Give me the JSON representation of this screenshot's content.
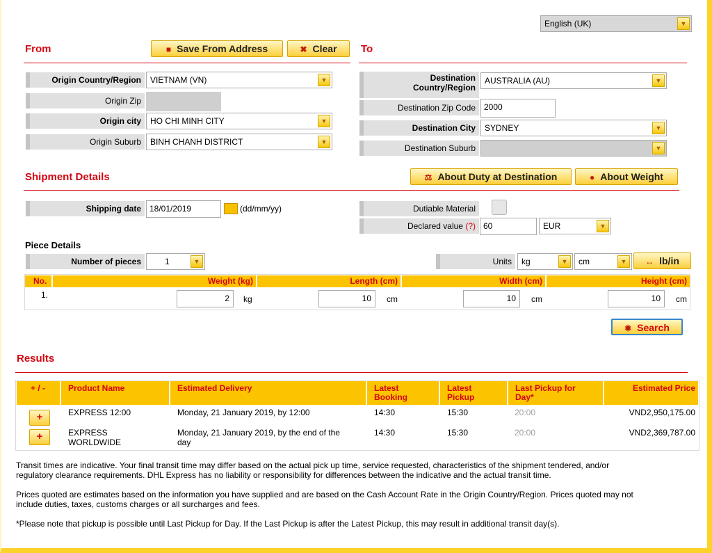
{
  "language": {
    "selected": "English (UK)"
  },
  "from": {
    "title": "From",
    "save_button": "Save From Address",
    "clear_button": "Clear",
    "country_label": "Origin Country/Region",
    "country_value": "VIETNAM (VN)",
    "zip_label": "Origin Zip",
    "city_label": "Origin city",
    "city_value": "HO CHI MINH CITY",
    "suburb_label": "Origin Suburb",
    "suburb_value": "BINH CHANH DISTRICT"
  },
  "to": {
    "title": "To",
    "country_label_1": "Destination",
    "country_label_2": "Country/Region",
    "country_value": "AUSTRALIA (AU)",
    "zip_label": "Destination Zip Code",
    "zip_value": "2000",
    "city_label": "Destination City",
    "city_value": "SYDNEY",
    "suburb_label": "Destination Suburb",
    "suburb_value": ""
  },
  "shipment": {
    "title": "Shipment Details",
    "duty_button": "About Duty at Destination",
    "weight_button": "About Weight",
    "date_label": "Shipping date",
    "date_value": "18/01/2019",
    "date_format": "(dd/mm/yy)",
    "dutiable_label": "Dutiable Material",
    "declared_label": "Declared value",
    "declared_help": "(?)",
    "declared_value": "60",
    "currency": "EUR"
  },
  "pieces": {
    "title": "Piece Details",
    "count_label": "Number of pieces",
    "count_value": "1",
    "units_label": "Units",
    "weight_unit": "kg",
    "length_unit": "cm",
    "toggle_button": "lb/in",
    "columns": {
      "no": "No.",
      "weight": "Weight (kg)",
      "length": "Length (cm)",
      "width": "Width (cm)",
      "height": "Height (cm)"
    },
    "row": {
      "no": "1.",
      "weight": "2",
      "weight_unit": "kg",
      "length": "10",
      "length_unit": "cm",
      "width": "10",
      "width_unit": "cm",
      "height": "10",
      "height_unit": "cm"
    },
    "search_button": "Search"
  },
  "results": {
    "title": "Results",
    "columns": {
      "toggle": "+ / -",
      "product": "Product Name",
      "delivery": "Estimated Delivery",
      "booking": [
        "Latest",
        "Booking"
      ],
      "pickup": [
        "Latest",
        "Pickup"
      ],
      "last_pickup": [
        "Last Pickup for",
        "Day*"
      ],
      "price": "Estimated Price"
    },
    "rows": [
      {
        "product": [
          "EXPRESS 12:00",
          ""
        ],
        "delivery": [
          "Monday, 21 January 2019, by 12:00",
          ""
        ],
        "booking": "14:30",
        "pickup": "15:30",
        "last_pickup": "20:00",
        "price": "VND2,950,175.00"
      },
      {
        "product": [
          "EXPRESS",
          "WORLDWIDE"
        ],
        "delivery": [
          "Monday, 21 January 2019, by the end of the",
          "day"
        ],
        "booking": "14:30",
        "pickup": "15:30",
        "last_pickup": "20:00",
        "price": "VND2,369,787.00"
      }
    ],
    "plus": "+"
  },
  "notes": {
    "transit": [
      "Transit times are indicative. Your final transit time may differ based on the actual pick up time, service requested, characteristics of the shipment tendered, and/or",
      "regulatory clearance requirements. DHL Express has no liability or responsibility for differences between the indicative and the actual transit time."
    ],
    "prices": [
      "Prices quoted are estimates based on the information you have supplied and are based on the Cash Account Rate in the Origin Country/Region. Prices quoted may not",
      "include duties, taxes, customs charges or all surcharges and fees."
    ],
    "pickup": "*Please note that pickup is possible until Last Pickup for Day. If the Last Pickup is after the Latest Pickup, this may result in additional transit day(s)."
  },
  "icons": {
    "arrow": "chevron-down-icon",
    "save": "save-icon",
    "clear": "close-icon",
    "duty": "scale-icon",
    "info": "info-icon",
    "calendar": "calendar-icon",
    "swap": "swap-icon",
    "search": "gear-icon"
  },
  "colors": {
    "accent": "#d40511",
    "yellow": "#fcc300",
    "border": "#fcd22b"
  }
}
